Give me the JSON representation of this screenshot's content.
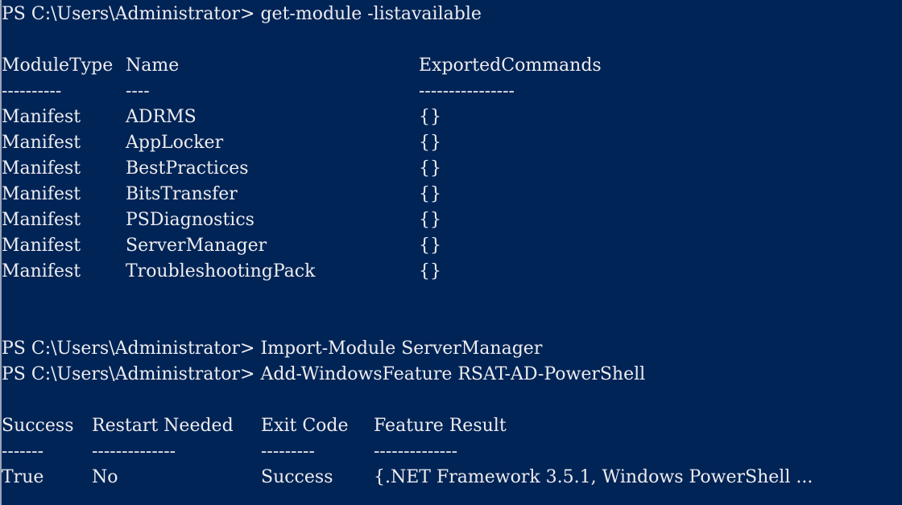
{
  "prompt": "PS C:\\Users\\Administrator> ",
  "commands": [
    "get-module -listavailable",
    "Import-Module ServerManager",
    "Add-WindowsFeature RSAT-AD-PowerShell"
  ],
  "modules_table": {
    "headers": [
      "ModuleType",
      "Name",
      "ExportedCommands"
    ],
    "underlines": [
      "----------",
      "----",
      "----------------"
    ],
    "rows": [
      [
        "Manifest",
        "ADRMS",
        "{}"
      ],
      [
        "Manifest",
        "AppLocker",
        "{}"
      ],
      [
        "Manifest",
        "BestPractices",
        "{}"
      ],
      [
        "Manifest",
        "BitsTransfer",
        "{}"
      ],
      [
        "Manifest",
        "PSDiagnostics",
        "{}"
      ],
      [
        "Manifest",
        "ServerManager",
        "{}"
      ],
      [
        "Manifest",
        "TroubleshootingPack",
        "{}"
      ]
    ]
  },
  "feature_table": {
    "headers": [
      "Success",
      "Restart Needed",
      "Exit Code",
      "Feature Result"
    ],
    "underlines": [
      "-------",
      "--------------",
      "---------",
      "--------------"
    ],
    "rows": [
      [
        "True",
        "No",
        "Success",
        "{.NET Framework 3.5.1, Windows PowerShell ..."
      ]
    ]
  },
  "colors": {
    "background": "#012456",
    "foreground": "#eeedf0"
  }
}
